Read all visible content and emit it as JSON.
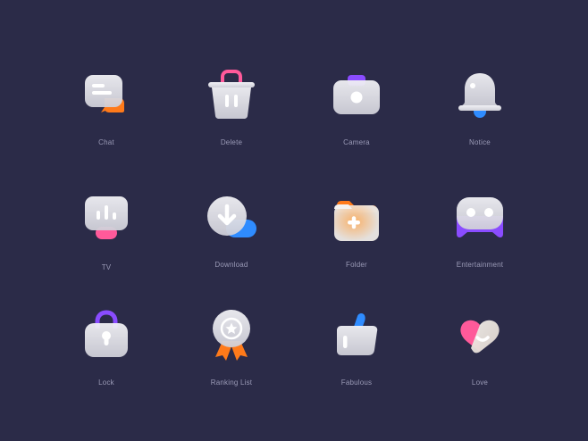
{
  "icons": [
    {
      "label": "Chat",
      "icon": "chat-icon"
    },
    {
      "label": "Delete",
      "icon": "delete-icon"
    },
    {
      "label": "Camera",
      "icon": "camera-icon"
    },
    {
      "label": "Notice",
      "icon": "bell-icon"
    },
    {
      "label": "TV",
      "icon": "tv-icon"
    },
    {
      "label": "Download",
      "icon": "download-icon"
    },
    {
      "label": "Folder",
      "icon": "folder-icon"
    },
    {
      "label": "Entertainment",
      "icon": "gamepad-icon"
    },
    {
      "label": "Lock",
      "icon": "lock-icon"
    },
    {
      "label": "Ranking List",
      "icon": "medal-icon"
    },
    {
      "label": "Fabulous",
      "icon": "thumbs-up-icon"
    },
    {
      "label": "Love",
      "icon": "heart-icon"
    }
  ],
  "colors": {
    "background": "#2b2b48",
    "glass": "#e4e4ea",
    "orange": "#ff7a1a",
    "pink": "#ff5a9a",
    "purple": "#8a4cff",
    "blue": "#2f8cff",
    "label": "#9a9ab6"
  }
}
